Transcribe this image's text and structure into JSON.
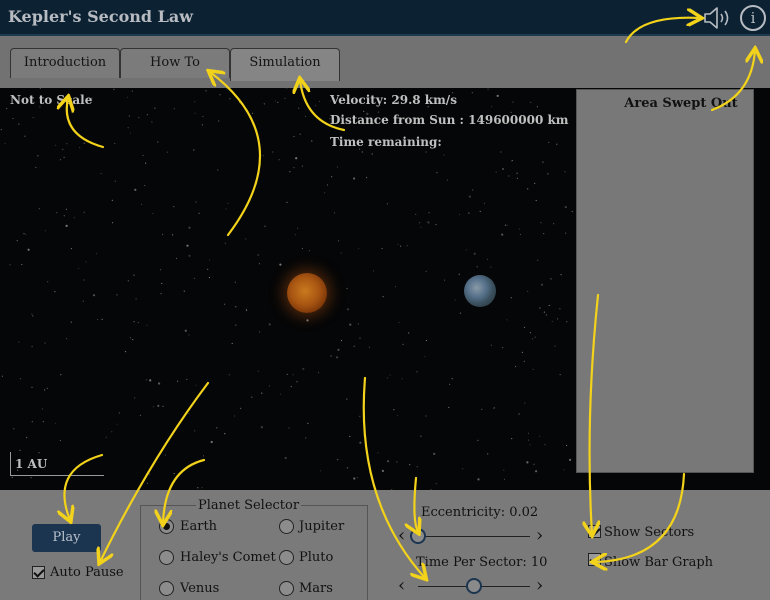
{
  "app": {
    "title": "Kepler's Second Law",
    "info_glyph": "i"
  },
  "tabs": [
    {
      "label": "Introduction",
      "active": false
    },
    {
      "label": "How To",
      "active": false
    },
    {
      "label": "Simulation",
      "active": true
    }
  ],
  "simulation": {
    "scale_note": "Not to Scale",
    "velocity": "Velocity: 29.8 km/s",
    "distance": "Distance from Sun : 149600000 km",
    "time_remaining": "Time remaining:",
    "scale_label": "1 AU"
  },
  "area_panel": {
    "title": "Area Swept Out"
  },
  "controls": {
    "play_label": "Play",
    "auto_pause_label": "Auto Pause",
    "auto_pause_checked": true,
    "planet_selector": {
      "title": "Planet Selector",
      "options": [
        {
          "label": "Earth",
          "selected": true
        },
        {
          "label": "Jupiter",
          "selected": false
        },
        {
          "label": "Haley's Comet",
          "selected": false
        },
        {
          "label": "Pluto",
          "selected": false
        },
        {
          "label": "Venus",
          "selected": false
        },
        {
          "label": "Mars",
          "selected": false
        }
      ]
    },
    "eccentricity": {
      "label": "Eccentricity: 0.02",
      "value": 0.02,
      "fraction": 0.0
    },
    "time_per_sector": {
      "label": "Time Per Sector: 10",
      "value": 10,
      "fraction": 0.5
    },
    "show_sectors": {
      "label": "Show Sectors",
      "checked": true
    },
    "show_bar_graph": {
      "label": "Show Bar Graph",
      "checked": true
    }
  },
  "icons": {
    "sound": "speaker-icon",
    "info": "info-icon",
    "left_arrow": "chevron-left-icon",
    "right_arrow": "chevron-right-icon"
  },
  "colors": {
    "header": "#0c2233",
    "play_button": "#1b3550",
    "annotation": "#f2d21a"
  }
}
